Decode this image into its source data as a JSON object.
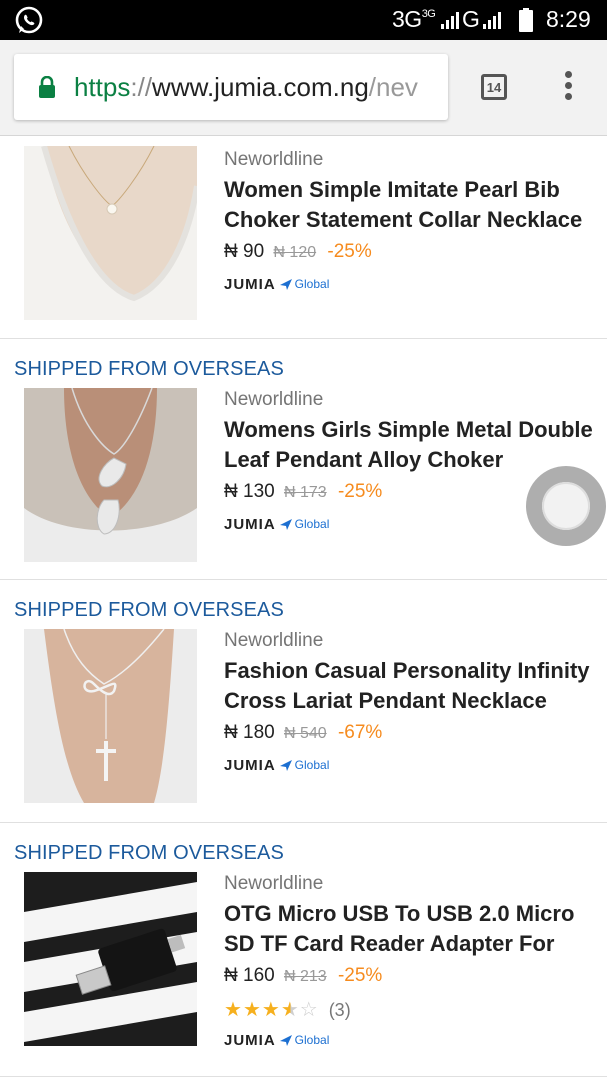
{
  "status_bar": {
    "network_label": "3G",
    "network_sub": "3G",
    "network_label_2": "G",
    "time": "8:29"
  },
  "browser": {
    "url_scheme": "https",
    "url_sep": "://",
    "url_host": "www.jumia.com.ng",
    "url_path": "/nev",
    "tab_count": "14"
  },
  "products": [
    {
      "shipped_from": "",
      "brand": "Neworldline",
      "name": "Women Simple Imitate Pearl Bib Choker Statement Collar Necklace",
      "price": "₦ 90",
      "old_price": "₦ 120",
      "discount": "-25%",
      "badge": "JUMIA",
      "badge_sub": "Global"
    },
    {
      "shipped_from": "SHIPPED FROM OVERSEAS",
      "brand": "Neworldline",
      "name": "Womens Girls Simple Metal Double Leaf Pendant Alloy Choker",
      "price": "₦ 130",
      "old_price": "₦ 173",
      "discount": "-25%",
      "badge": "JUMIA",
      "badge_sub": "Global"
    },
    {
      "shipped_from": "SHIPPED FROM OVERSEAS",
      "brand": "Neworldline",
      "name": "Fashion Casual Personality Infinity Cross Lariat Pendant Necklace",
      "price": "₦ 180",
      "old_price": "₦ 540",
      "discount": "-67%",
      "badge": "JUMIA",
      "badge_sub": "Global"
    },
    {
      "shipped_from": "SHIPPED FROM OVERSEAS",
      "brand": "Neworldline",
      "name": "OTG Micro USB To USB 2.0 Micro SD TF Card Reader Adapter For",
      "price": "₦ 160",
      "old_price": "₦ 213",
      "discount": "-25%",
      "rating": 3.5,
      "rating_count": "(3)",
      "badge": "JUMIA",
      "badge_sub": "Global"
    }
  ],
  "colors": {
    "overseas_text": "#1c5a9c",
    "discount": "#f68b1e",
    "secure": "#0b8043",
    "star": "#f6b01e"
  }
}
